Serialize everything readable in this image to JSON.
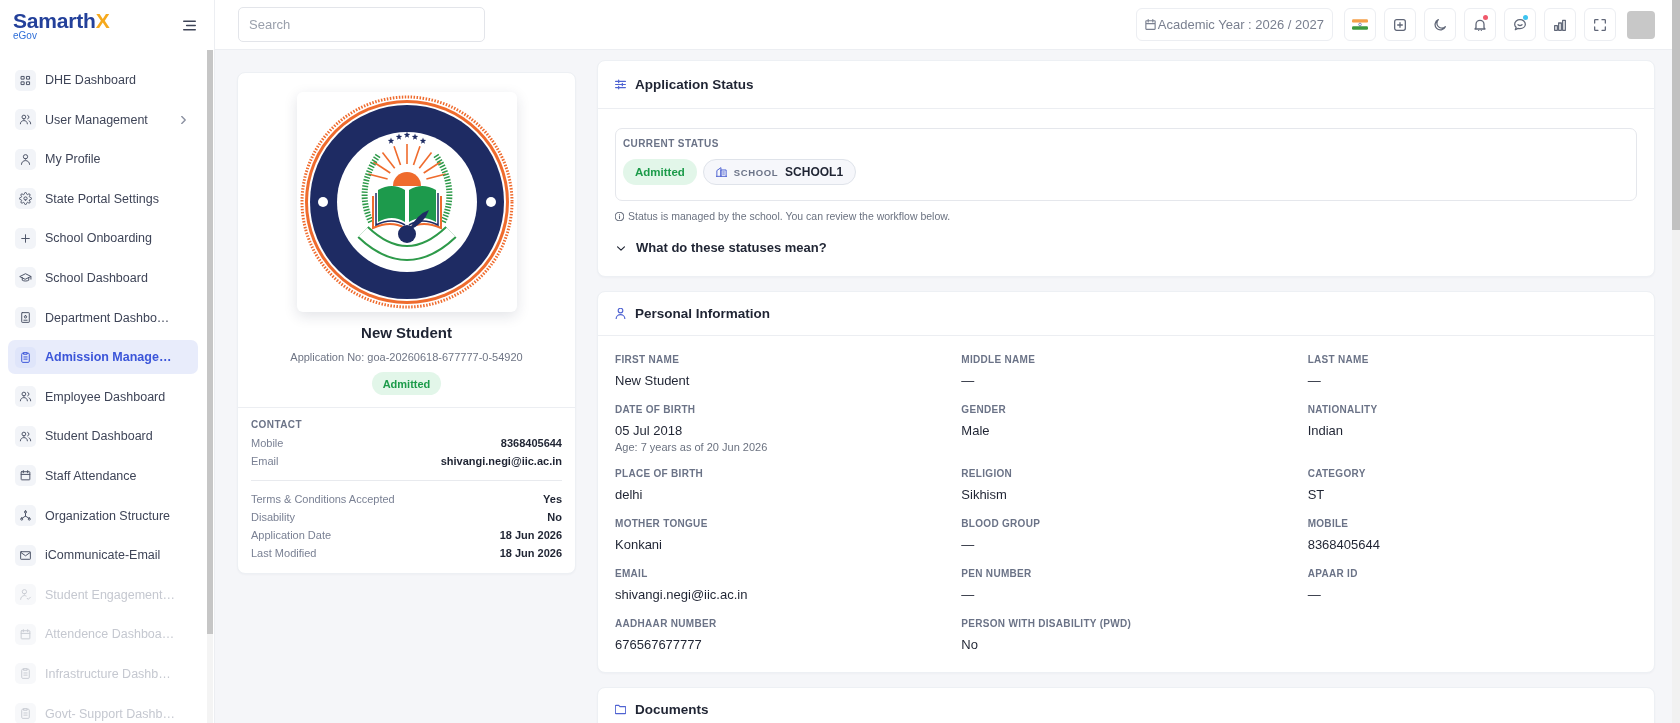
{
  "sidebar": {
    "logo": {
      "name": "Samarth",
      "accent": "X",
      "subtitle": "eGov"
    },
    "items": [
      {
        "label": "DHE Dashboard",
        "selected": false,
        "disabled": false,
        "submenu": false
      },
      {
        "label": "User Management",
        "selected": false,
        "disabled": false,
        "submenu": true
      },
      {
        "label": "My Profile",
        "selected": false,
        "disabled": false,
        "submenu": false
      },
      {
        "label": "State Portal Settings",
        "selected": false,
        "disabled": false,
        "submenu": false
      },
      {
        "label": "School Onboarding",
        "selected": false,
        "disabled": false,
        "submenu": false
      },
      {
        "label": "School Dashboard",
        "selected": false,
        "disabled": false,
        "submenu": false
      },
      {
        "label": "Department Dashbo…",
        "selected": false,
        "disabled": false,
        "submenu": false
      },
      {
        "label": "Admission Manage…",
        "selected": true,
        "disabled": false,
        "submenu": false
      },
      {
        "label": "Employee Dashboard",
        "selected": false,
        "disabled": false,
        "submenu": false
      },
      {
        "label": "Student Dashboard",
        "selected": false,
        "disabled": false,
        "submenu": false
      },
      {
        "label": "Staff Attendance",
        "selected": false,
        "disabled": false,
        "submenu": false
      },
      {
        "label": "Organization Structure",
        "selected": false,
        "disabled": false,
        "submenu": false
      },
      {
        "label": "iCommunicate-Email",
        "selected": false,
        "disabled": false,
        "submenu": false
      },
      {
        "label": "Student Engagement…",
        "selected": false,
        "disabled": true,
        "submenu": false
      },
      {
        "label": "Attendence Dashboa…",
        "selected": false,
        "disabled": true,
        "submenu": false
      },
      {
        "label": "Infrastructure Dashb…",
        "selected": false,
        "disabled": true,
        "submenu": false
      },
      {
        "label": "Govt- Support Dashb…",
        "selected": false,
        "disabled": true,
        "submenu": false
      }
    ]
  },
  "topbar": {
    "search": {
      "placeholder": "Search"
    },
    "academic_year": "Academic Year : 2026 / 2027",
    "tools": [
      {
        "unread": false
      },
      {
        "unread": false
      },
      {
        "unread": false
      },
      {
        "unread": true,
        "color": "#f0596b"
      },
      {
        "unread": true,
        "color": "#3ec4f0"
      },
      {
        "unread": false
      },
      {
        "unread": false
      }
    ]
  },
  "profile": {
    "name": "New Student",
    "application_no": "Application No: goa-20260618-677777-0-54920",
    "status": "Admitted",
    "contact_heading": "CONTACT",
    "contact": [
      {
        "label": "Mobile",
        "value": "8368405644"
      },
      {
        "label": "Email",
        "value": "shivangi.negi@iic.ac.in"
      }
    ],
    "details": [
      {
        "label": "Terms & Conditions Accepted",
        "value": "Yes"
      },
      {
        "label": "Disability",
        "value": "No"
      },
      {
        "label": "Application Date",
        "value": "18 Jun 2026"
      },
      {
        "label": "Last Modified",
        "value": "18 Jun 2026"
      }
    ]
  },
  "application_status": {
    "title": "Application Status",
    "current_label": "CURRENT STATUS",
    "status": "Admitted",
    "school_label": "SCHOOL",
    "school": "SCHOOL1",
    "note": "Status is managed by the school. You can review the workflow below.",
    "help": {
      "label": "What do these statuses mean?",
      "expanded": false
    }
  },
  "personal_information": {
    "title": "Personal Information",
    "fields": [
      {
        "label": "FIRST NAME",
        "value": "New Student"
      },
      {
        "label": "MIDDLE NAME",
        "value": "—"
      },
      {
        "label": "LAST NAME",
        "value": "—"
      },
      {
        "label": "DATE OF BIRTH",
        "value": "05 Jul 2018",
        "note": "Age: 7 years as of 20 Jun 2026"
      },
      {
        "label": "GENDER",
        "value": "Male"
      },
      {
        "label": "NATIONALITY",
        "value": "Indian"
      },
      {
        "label": "PLACE OF BIRTH",
        "value": "delhi"
      },
      {
        "label": "RELIGION",
        "value": "Sikhism"
      },
      {
        "label": "CATEGORY",
        "value": "ST"
      },
      {
        "label": "MOTHER TONGUE",
        "value": "Konkani"
      },
      {
        "label": "BLOOD GROUP",
        "value": "—"
      },
      {
        "label": "MOBILE",
        "value": "8368405644"
      },
      {
        "label": "EMAIL",
        "value": "shivangi.negi@iic.ac.in"
      },
      {
        "label": "PEN NUMBER",
        "value": "—"
      },
      {
        "label": "APAAR ID",
        "value": "—"
      },
      {
        "label": "AADHAAR NUMBER",
        "value": "676567677777"
      },
      {
        "label": "PERSON WITH DISABILITY (PWD)",
        "value": "No"
      }
    ]
  },
  "documents": {
    "title": "Documents"
  }
}
